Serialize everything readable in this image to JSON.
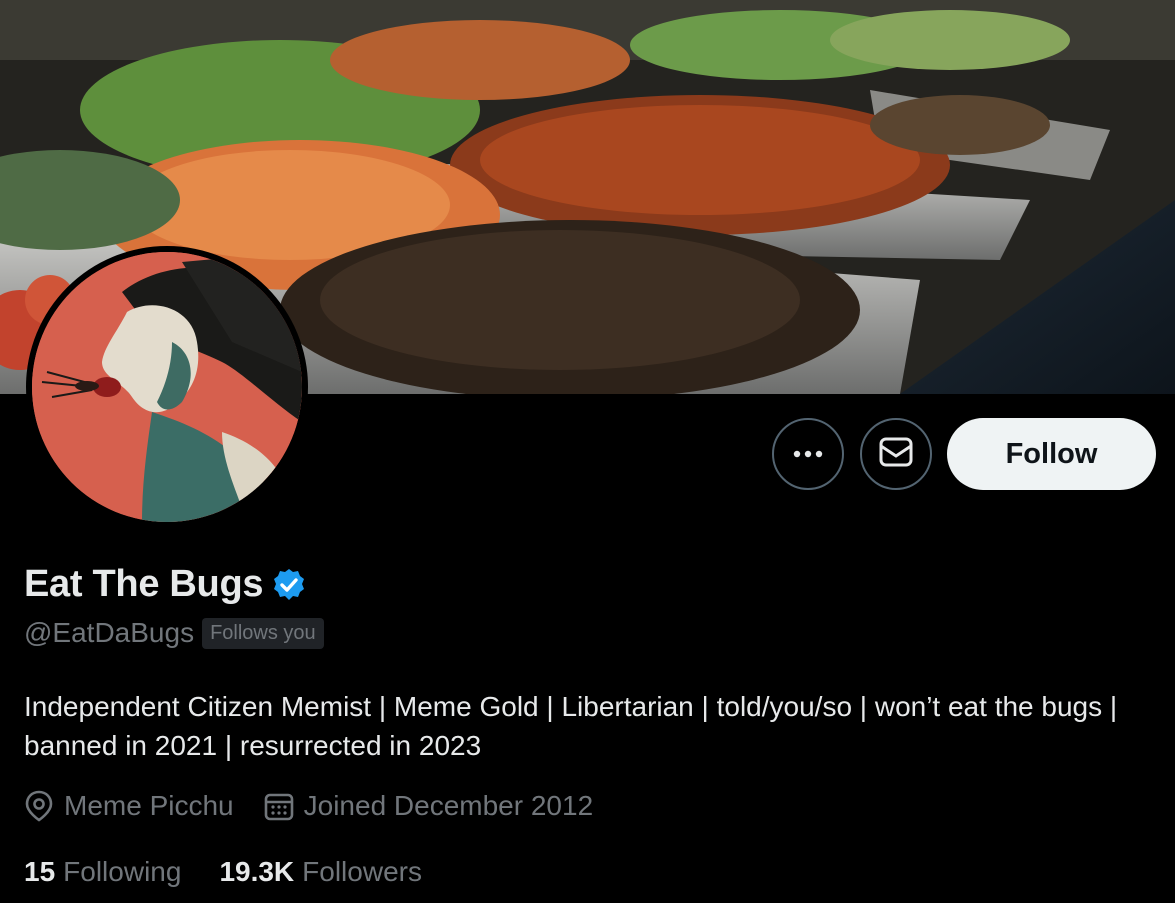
{
  "profile": {
    "display_name": "Eat The Bugs",
    "handle": "@EatDaBugs",
    "follows_you_badge": "Follows you",
    "bio": "Independent Citizen Memist | Meme Gold | Libertarian | told/you/so | won’t eat the bugs | banned in 2021 | resurrected in 2023",
    "location": "Meme Picchu",
    "joined": "Joined December 2012",
    "verified": true
  },
  "stats": {
    "following_count": "15",
    "following_label": "Following",
    "followers_count": "19.3K",
    "followers_label": "Followers"
  },
  "actions": {
    "more_icon": "more-horizontal-icon",
    "message_icon": "envelope-icon",
    "follow_label": "Follow"
  },
  "colors": {
    "background": "#000000",
    "primary_text": "#e7e9ea",
    "secondary_text": "#71767b",
    "verified_blue": "#1d9bf0",
    "follow_button_bg": "#eff3f4",
    "avatar_bg": "#d6604e"
  }
}
